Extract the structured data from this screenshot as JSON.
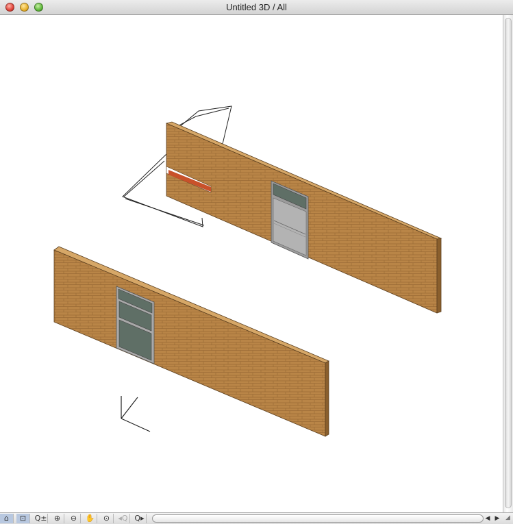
{
  "window": {
    "title": "Untitled 3D / All"
  },
  "colors": {
    "brick": "#b98547",
    "brick_dark": "#8a5f2d",
    "edge": "#5a3e1e",
    "glass": "#5f6f66",
    "frame": "#a9a9a9",
    "slab": "#c8512a"
  },
  "toolbar": {
    "tools": [
      {
        "name": "camera-icon",
        "glyph": "⌂",
        "active": true
      },
      {
        "name": "zoom-window-icon",
        "glyph": "⊡",
        "active": true
      },
      {
        "name": "zoom-fit-icon",
        "glyph": "Q±"
      },
      {
        "name": "zoom-in-icon",
        "glyph": "⊕"
      },
      {
        "name": "zoom-out-icon",
        "glyph": "⊖"
      },
      {
        "name": "pan-hand-icon",
        "glyph": "✋"
      },
      {
        "name": "zoom-reset-icon",
        "glyph": "⊙"
      },
      {
        "name": "zoom-previous-icon",
        "glyph": "◂Q",
        "disabled": true
      },
      {
        "name": "zoom-next-icon",
        "glyph": "Q▸"
      }
    ]
  }
}
